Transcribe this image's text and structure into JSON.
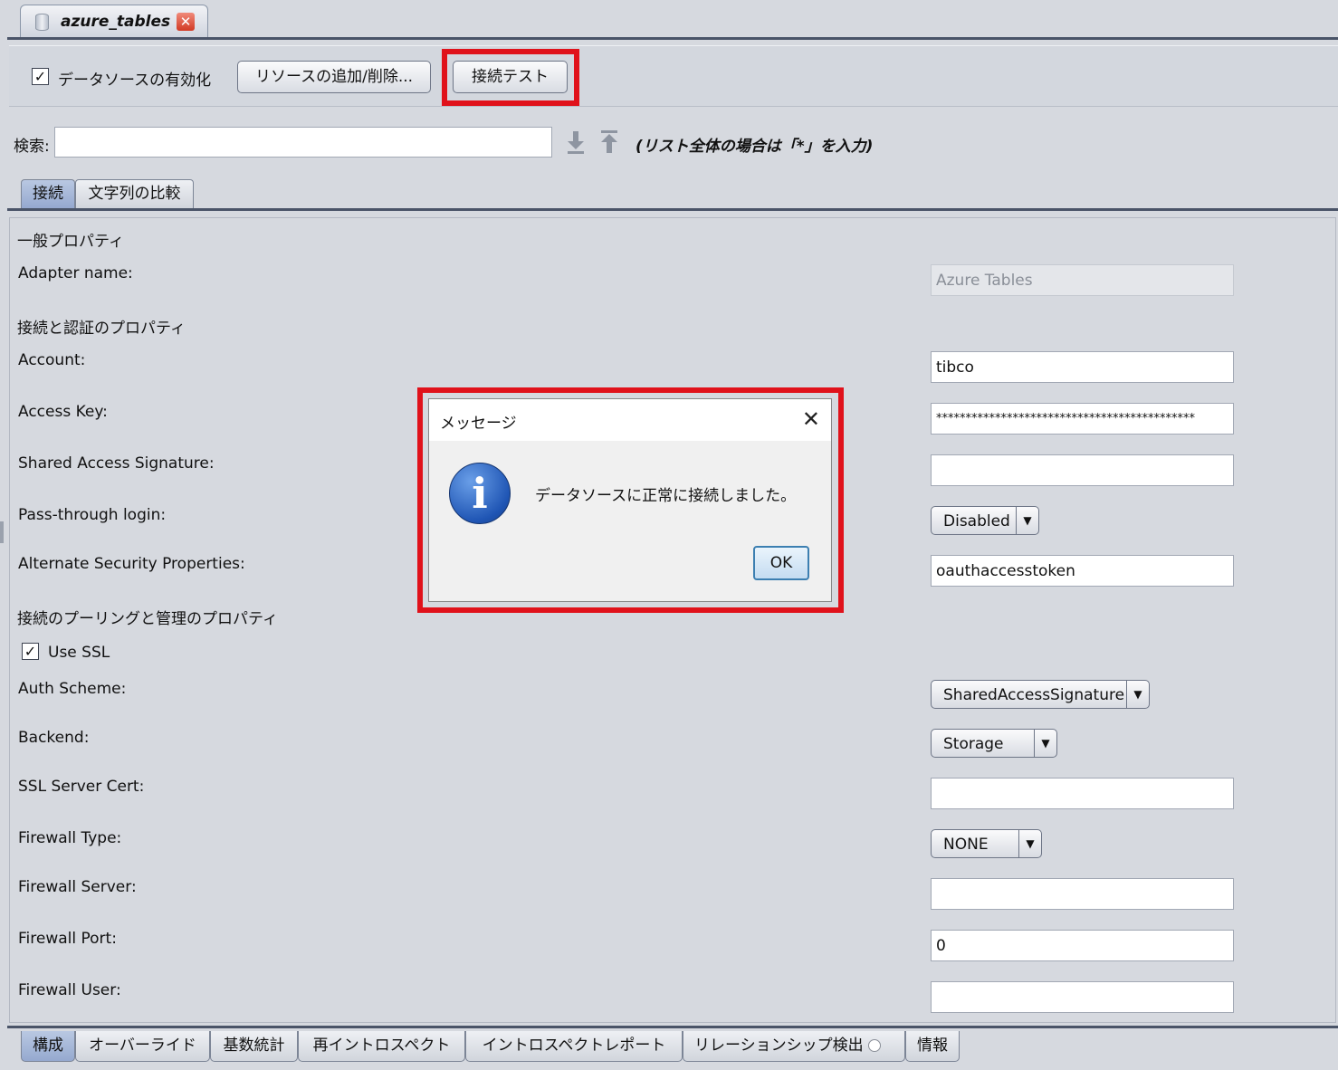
{
  "editor_tab": {
    "title": "azure_tables",
    "close_icon": "close-icon"
  },
  "toolbar": {
    "enable_label": "データソースの有効化",
    "enable_checked": true,
    "add_remove_label": "リソースの追加/削除...",
    "test_label": "接続テスト"
  },
  "search": {
    "label": "検索:",
    "value": "",
    "hint": "(リスト全体の場合は「*」を入力)"
  },
  "subtabs": [
    "接続",
    "文字列の比較"
  ],
  "sections": {
    "general": "一般プロパティ",
    "auth": "接続と認証のプロパティ",
    "pooling": "接続のプーリングと管理のプロパティ"
  },
  "fields": {
    "adapter_name": {
      "label": "Adapter name:",
      "value": "Azure Tables"
    },
    "account": {
      "label": "Account:",
      "value": "tibco"
    },
    "access_key": {
      "label": "Access Key:",
      "value": "********************************************"
    },
    "sas": {
      "label": "Shared Access Signature:",
      "value": ""
    },
    "passthrough": {
      "label": "Pass-through login:",
      "value": "Disabled"
    },
    "alt_security": {
      "label": "Alternate Security Properties:",
      "value": "oauthaccesstoken"
    },
    "use_ssl": {
      "label": "Use SSL",
      "checked": true
    },
    "auth_scheme": {
      "label": "Auth Scheme:",
      "value": "SharedAccessSignature"
    },
    "backend": {
      "label": "Backend:",
      "value": "Storage"
    },
    "ssl_cert": {
      "label": "SSL Server Cert:",
      "value": ""
    },
    "fw_type": {
      "label": "Firewall Type:",
      "value": "NONE"
    },
    "fw_server": {
      "label": "Firewall Server:",
      "value": ""
    },
    "fw_port": {
      "label": "Firewall Port:",
      "value": "0"
    },
    "fw_user": {
      "label": "Firewall User:",
      "value": ""
    }
  },
  "dialog": {
    "title": "メッセージ",
    "message": "データソースに正常に接続しました。",
    "ok_label": "OK",
    "icon": "info-icon"
  },
  "bottom_tabs": [
    "構成",
    "オーバーライド",
    "基数統計",
    "再イントロスペクト",
    "イントロスペクトレポート",
    "リレーションシップ検出",
    "情報"
  ],
  "highlight_color": "#e0121b"
}
